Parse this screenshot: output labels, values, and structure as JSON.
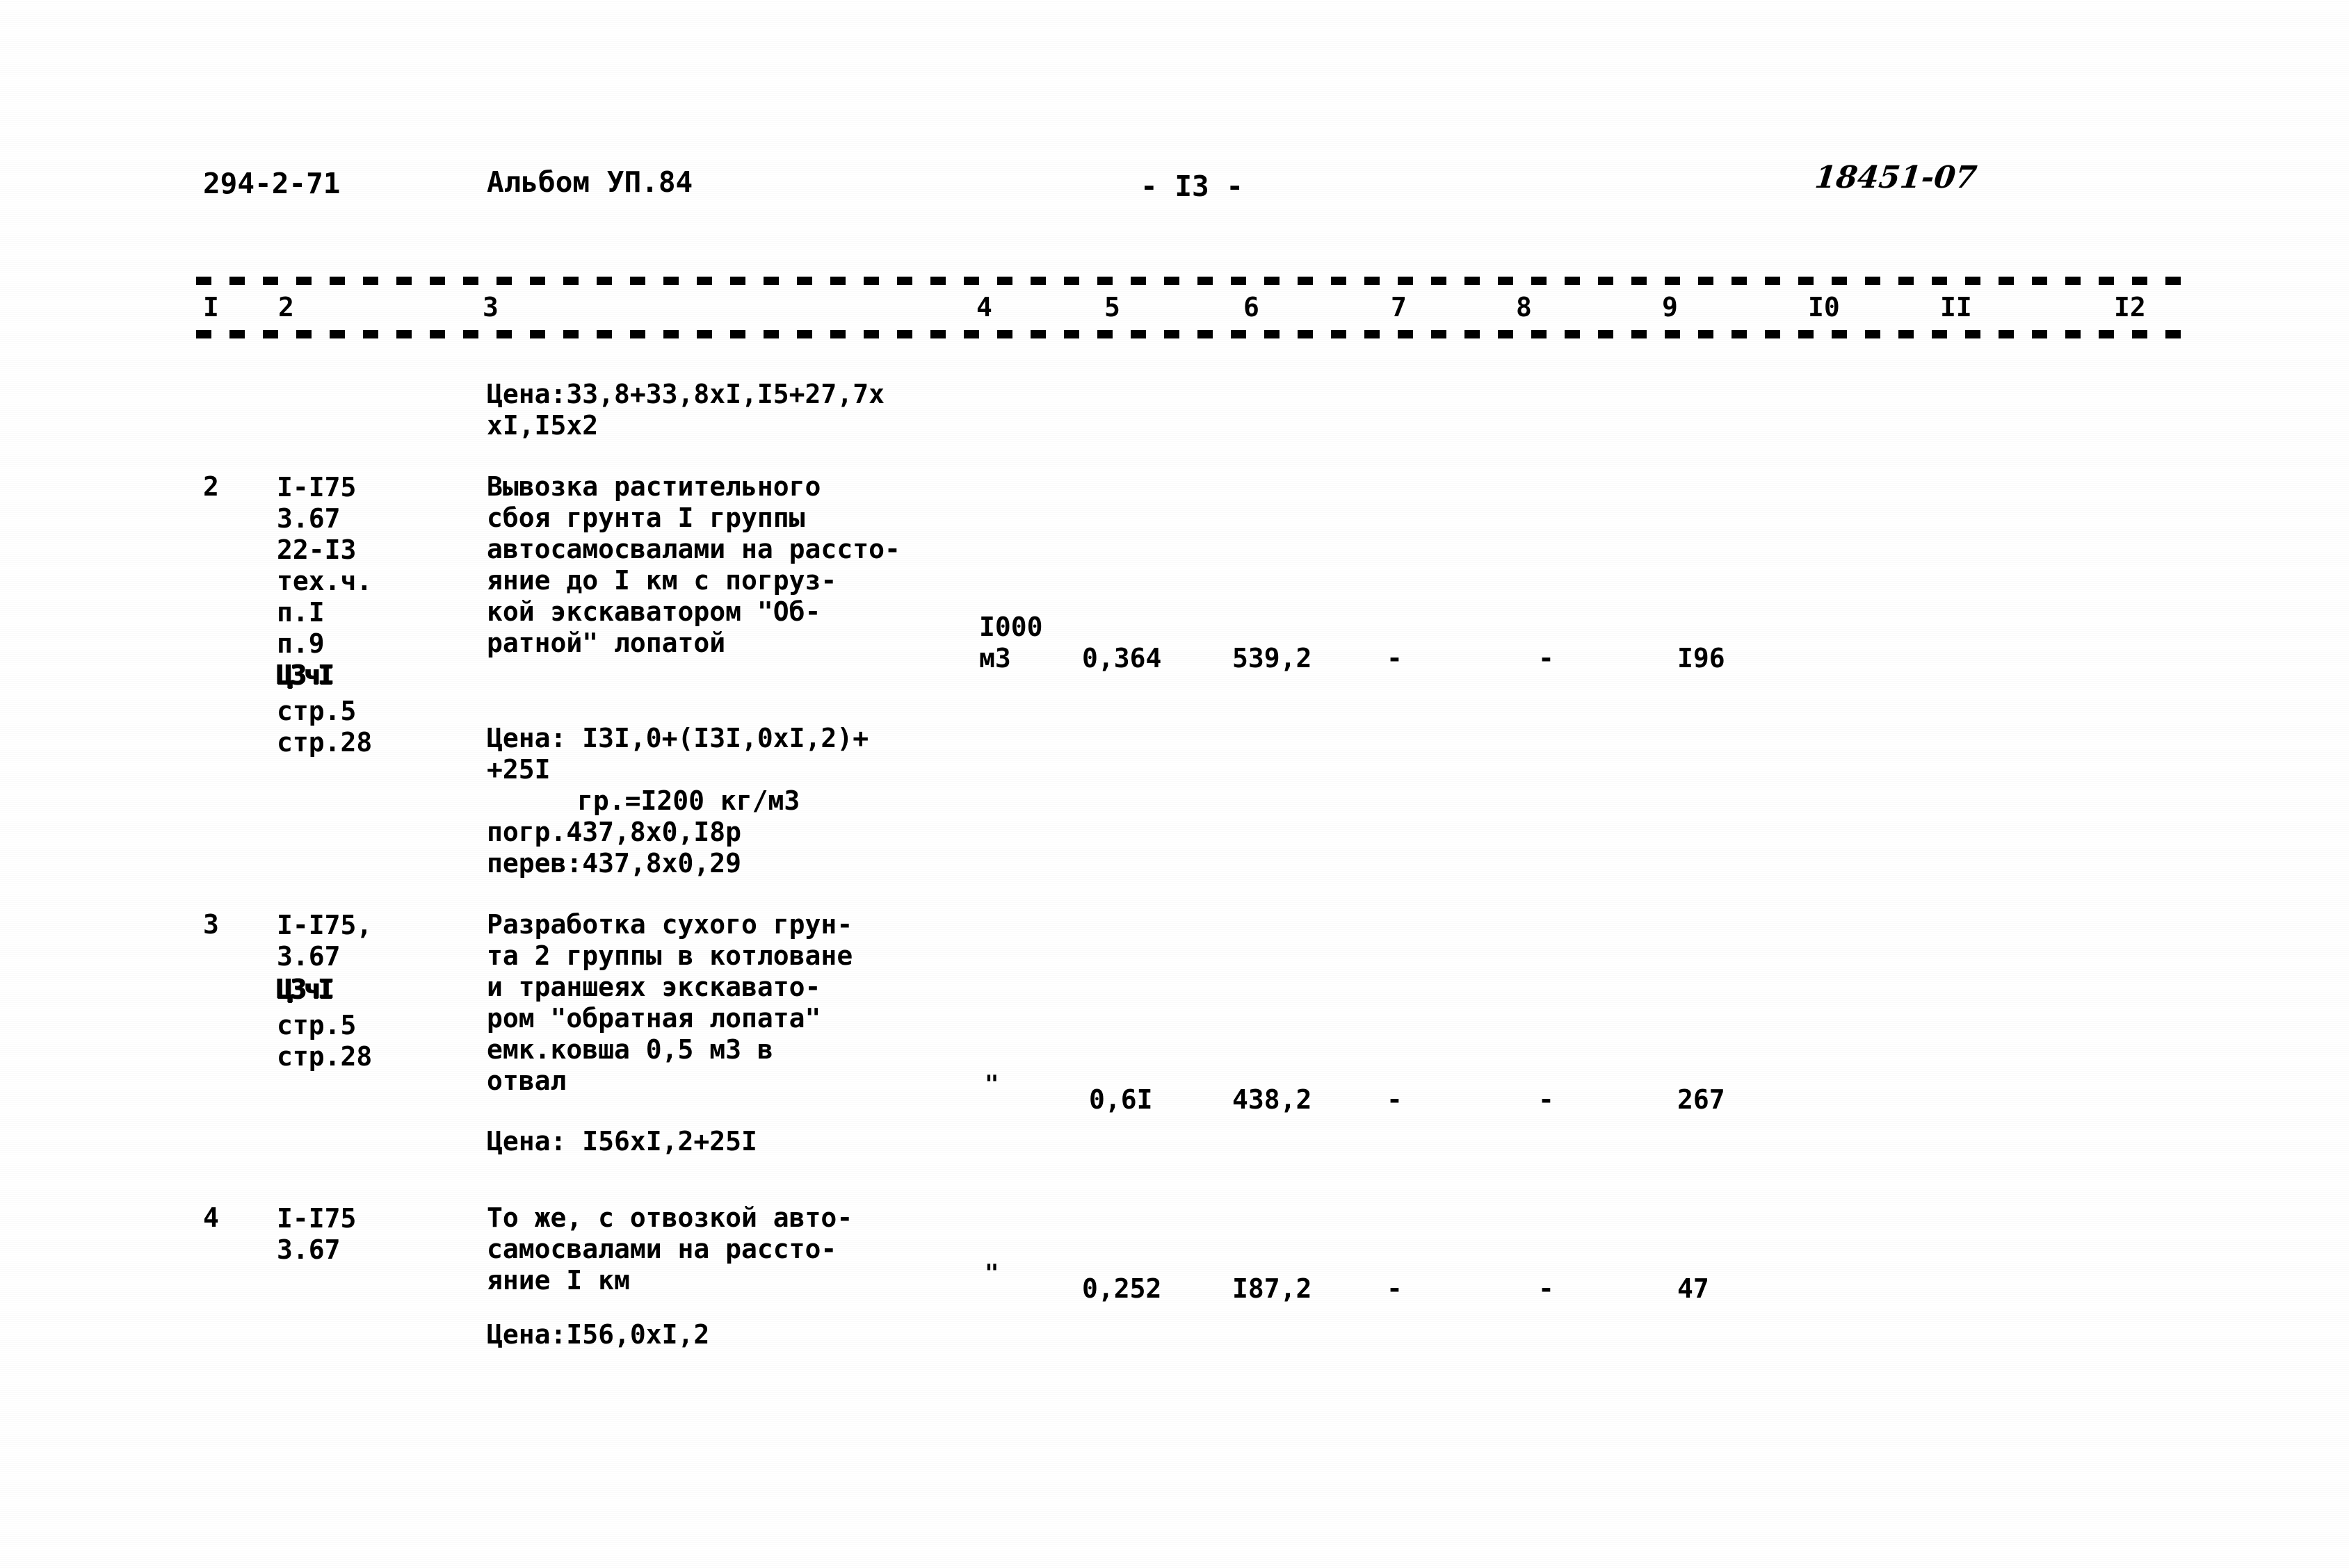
{
  "document": {
    "doc_code": "294-2-71",
    "album": "Альбом УП.84",
    "page_marker": "- I3 -",
    "stamp": "18451-07"
  },
  "table": {
    "column_numbers": [
      "I",
      "2",
      "3",
      "4",
      "5",
      "6",
      "7",
      "8",
      "9",
      "I0",
      "II",
      "I2"
    ],
    "continued_note": {
      "line1": "Цена:33,8+33,8xI,I5+27,7x",
      "line2": "xI,I5x2"
    },
    "rows": [
      {
        "num": "2",
        "codes": [
          "I-I75",
          "3.67",
          "22-I3",
          "тех.ч.",
          "п.I",
          "п.9",
          "Ц3чI",
          "стр.5",
          "стр.28"
        ],
        "description": [
          "Вывозка растительного",
          "сбоя грунта I группы",
          "автосамосвалами на рассто-",
          "яние до I км с погруз-",
          "кой экскаватором \"Об-",
          "ратной\" лопатой"
        ],
        "unit_line1": "I000",
        "unit_line2": "м3",
        "col5": "0,364",
        "col6": "539,2",
        "col7": "-",
        "col8": "-",
        "col9": "I96",
        "notes": [
          "Цена: I3I,0+(I3I,0xI,2)+",
          "+25I",
          "гр.=I200 кг/м3",
          "погр.437,8x0,I8р",
          "перев:437,8x0,29"
        ]
      },
      {
        "num": "3",
        "codes": [
          "I-I75,",
          "3.67",
          "Ц3чI",
          "стр.5",
          "стр.28"
        ],
        "description": [
          "Разработка сухого грун-",
          "та 2 группы в котловане",
          "и траншеях экскавато-",
          "ром \"обратная лопата\"",
          "емк.ковша 0,5 м3 в",
          "отвал"
        ],
        "unit_line1": "",
        "unit_line2": "\"",
        "col5": "0,6I",
        "col6": "438,2",
        "col7": "-",
        "col8": "-",
        "col9": "267",
        "notes": [
          "Цена: I56xI,2+25I"
        ]
      },
      {
        "num": "4",
        "codes": [
          "I-I75",
          "3.67"
        ],
        "description": [
          "То же, с отвозкой авто-",
          "самосвалами на рассто-",
          "яние I км"
        ],
        "unit_line1": "",
        "unit_line2": "\"",
        "col5": "0,252",
        "col6": "I87,2",
        "col7": "-",
        "col8": "-",
        "col9": "47",
        "notes": [
          "Цена:I56,0xI,2"
        ]
      }
    ]
  }
}
